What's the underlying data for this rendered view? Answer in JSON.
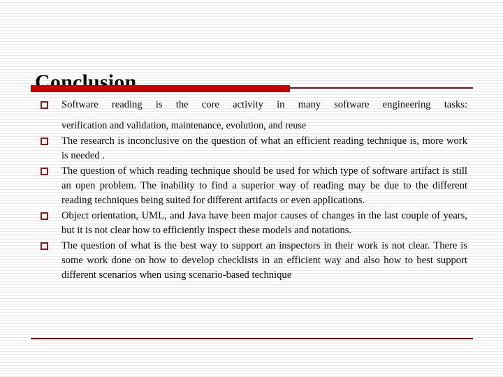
{
  "slide": {
    "title": "Conclusion",
    "accent_color_bar": "#c90003",
    "accent_color_line": "#6e1212",
    "bullet_marker_color": "#8d1b20",
    "text_color": "#0a0a0a",
    "background_color": "#ffffff",
    "bullet_glyph": "square-outline"
  },
  "bullets": [
    {
      "id": "bullet-1",
      "line_a": "Software reading is the core activity in many software engineering tasks:",
      "line_b": "verification and validation, maintenance, evolution, and reuse",
      "text": "Software reading is the core activity in many software engineering tasks: verification and validation, maintenance, evolution, and reuse"
    },
    {
      "id": "bullet-2",
      "text": "The research is inconclusive on the question of what an efficient reading technique is, more work is needed ."
    },
    {
      "id": "bullet-3",
      "text": "The question of which reading technique should be used for which type of software artifact is still an open problem. The inability to find a superior way of reading may be due to the different reading techniques being suited for different artifacts or even applications."
    },
    {
      "id": "bullet-4",
      "text": "Object orientation, UML, and Java have been major causes of changes in the last couple of years, but it is not clear how to efficiently inspect these models and notations."
    },
    {
      "id": "bullet-5",
      "text": "The question of what is the best way to support an inspectors in their work is not clear. There is some work done on how to develop checklists in an efficient way and also how to best support different scenarios when using scenario-based technique"
    }
  ]
}
